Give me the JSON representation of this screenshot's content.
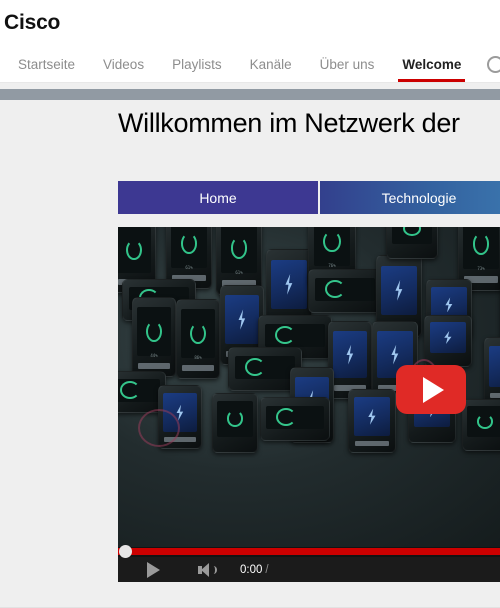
{
  "channel": {
    "title": "Cisco"
  },
  "nav": {
    "items": [
      {
        "label": "Startseite",
        "active": false
      },
      {
        "label": "Videos",
        "active": false
      },
      {
        "label": "Playlists",
        "active": false
      },
      {
        "label": "Kanäle",
        "active": false
      },
      {
        "label": "Über uns",
        "active": false
      },
      {
        "label": "Welcome",
        "active": true
      }
    ],
    "search_icon": "search-icon",
    "active_underline_color": "#cc0000"
  },
  "banner": {
    "band_color": "#919aa3"
  },
  "main": {
    "heading": "Willkommen im Netzwerk der",
    "tabs": [
      {
        "label": "Home",
        "color": "#3d3892",
        "selected": true
      },
      {
        "label": "Technologie",
        "color": "#33619f",
        "selected": false
      }
    ]
  },
  "video": {
    "play_overlay_icon": "youtube-play-icon",
    "play_overlay_color": "#e02a26",
    "controls": {
      "play_icon": "play-icon",
      "volume_icon": "volume-icon",
      "current_time": "0:00",
      "time_separator": "/",
      "progress_color": "#cc0000",
      "progress_percent": "0"
    }
  }
}
